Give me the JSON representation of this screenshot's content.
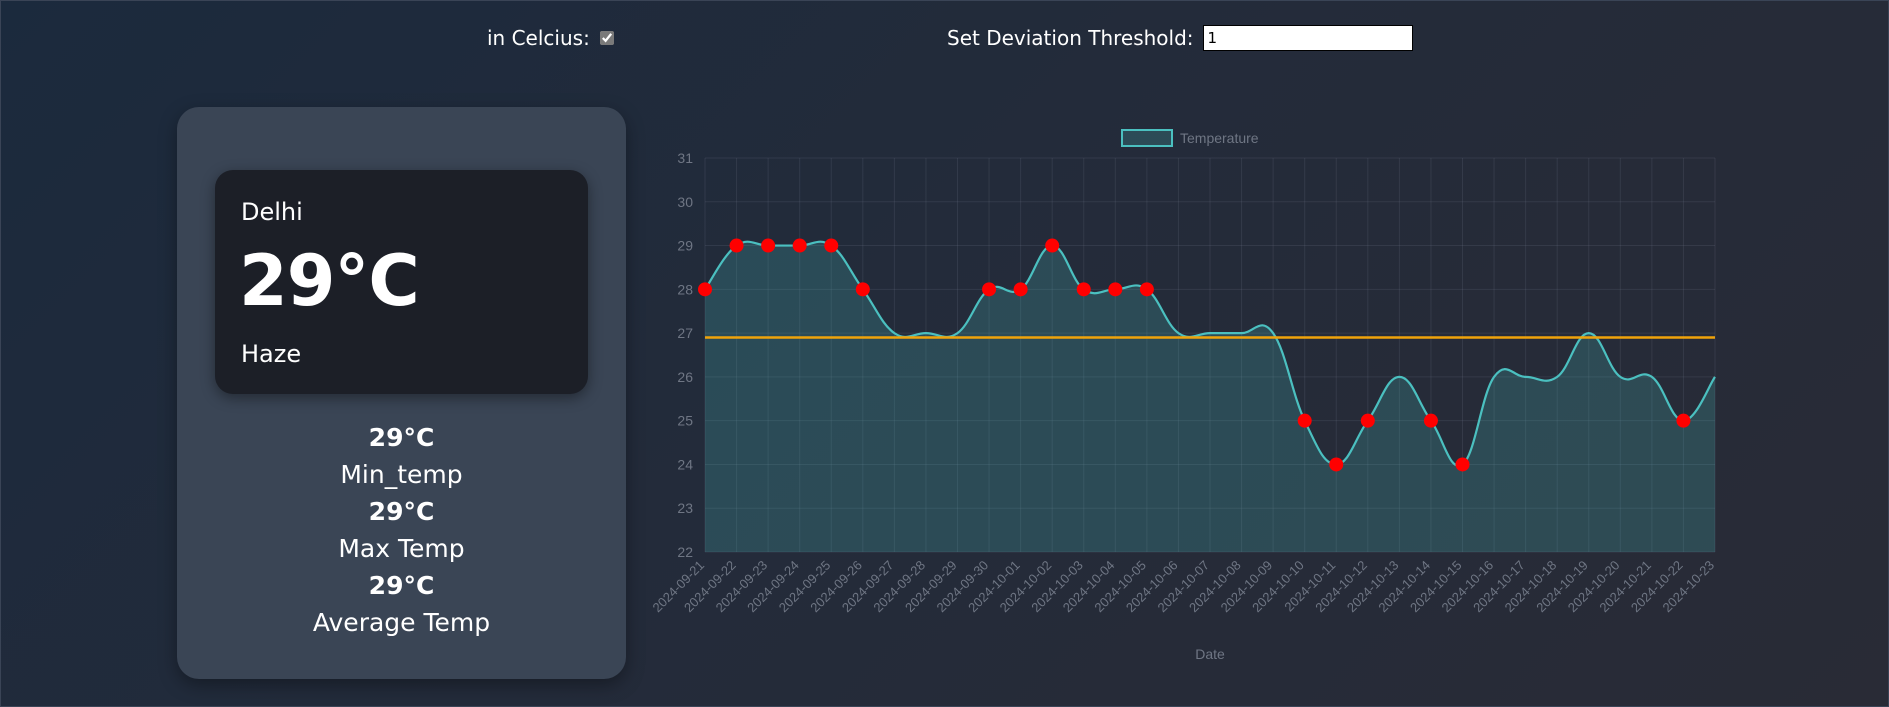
{
  "controls": {
    "celsius_label": "in Celcius:",
    "celsius_checked": true,
    "threshold_label": "Set Deviation Threshold:",
    "threshold_value": "1"
  },
  "weather": {
    "city": "Delhi",
    "temperature": "29°C",
    "condition": "Haze"
  },
  "stats": [
    {
      "value": "29°C",
      "label": "Min_temp"
    },
    {
      "value": "29°C",
      "label": "Max Temp"
    },
    {
      "value": "29°C",
      "label": "Average Temp"
    }
  ],
  "chart_data": {
    "type": "line",
    "xlabel": "Date",
    "ylabel": "",
    "ylim": [
      22,
      31
    ],
    "yticks": [
      22,
      23,
      24,
      25,
      26,
      27,
      28,
      29,
      30,
      31
    ],
    "grid": true,
    "legend_position": "top",
    "categories": [
      "2024-09-21",
      "2024-09-22",
      "2024-09-23",
      "2024-09-24",
      "2024-09-25",
      "2024-09-26",
      "2024-09-27",
      "2024-09-28",
      "2024-09-29",
      "2024-09-30",
      "2024-10-01",
      "2024-10-02",
      "2024-10-03",
      "2024-10-04",
      "2024-10-05",
      "2024-10-06",
      "2024-10-07",
      "2024-10-08",
      "2024-10-09",
      "2024-10-10",
      "2024-10-11",
      "2024-10-12",
      "2024-10-13",
      "2024-10-14",
      "2024-10-15",
      "2024-10-16",
      "2024-10-17",
      "2024-10-18",
      "2024-10-19",
      "2024-10-20",
      "2024-10-21",
      "2024-10-22",
      "2024-10-23"
    ],
    "series": [
      {
        "name": "Temperature",
        "values": [
          28,
          29,
          29,
          29,
          29,
          28,
          27,
          27,
          27,
          28,
          28,
          29,
          28,
          28,
          28,
          27,
          27,
          27,
          27,
          25,
          24,
          25,
          26,
          25,
          24,
          26,
          26,
          26,
          27,
          26,
          26,
          25,
          26
        ],
        "color": "#4bc0c0",
        "fill": "rgba(75,192,192,0.22)"
      }
    ],
    "deviation_points": [
      0,
      1,
      2,
      3,
      4,
      5,
      9,
      10,
      11,
      12,
      13,
      14,
      19,
      20,
      21,
      23,
      24,
      31
    ],
    "deviation_color": "#ff0000",
    "average_line": {
      "value": 26.9,
      "color": "#f0a30a"
    }
  }
}
